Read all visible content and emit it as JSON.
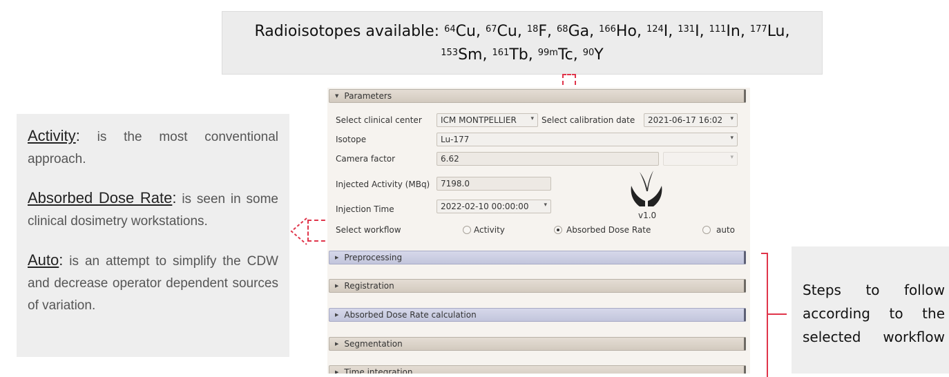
{
  "isotopes": {
    "prefix": "Radioisotopes available:",
    "items": [
      {
        "mass": "64",
        "symbol": "Cu"
      },
      {
        "mass": "67",
        "symbol": "Cu"
      },
      {
        "mass": "18",
        "symbol": "F"
      },
      {
        "mass": "68",
        "symbol": "Ga"
      },
      {
        "mass": "166",
        "symbol": "Ho"
      },
      {
        "mass": "124",
        "symbol": "I"
      },
      {
        "mass": "131",
        "symbol": "I"
      },
      {
        "mass": "111",
        "symbol": "In"
      },
      {
        "mass": "177",
        "symbol": "Lu"
      },
      {
        "mass": "153",
        "symbol": "Sm"
      },
      {
        "mass": "161",
        "symbol": "Tb"
      },
      {
        "mass": "99m",
        "symbol": "Tc"
      },
      {
        "mass": "90",
        "symbol": "Y"
      }
    ]
  },
  "notes": {
    "activity_term": "Activity",
    "activity_text": " is the most conventional approach.",
    "adr_term": "Absorbed Dose Rate",
    "adr_text": " is seen in some clinical dosimetry workstations.",
    "auto_term": "Auto",
    "auto_text": " is an attempt to simplify the CDW and decrease operator dependent sources of variation."
  },
  "steps_note": "Steps to follow according to the selected workflow",
  "app": {
    "parameters_title": "Parameters",
    "clinical_center_label": "Select clinical center",
    "clinical_center_value": "ICM MONTPELLIER",
    "calibration_date_label": "Select calibration date",
    "calibration_date_value": "2021-06-17 16:02",
    "isotope_label": "Isotope",
    "isotope_value": "Lu-177",
    "camera_factor_label": "Camera factor",
    "camera_factor_value": "6.62",
    "injected_activity_label": "Injected Activity (MBq)",
    "injected_activity_value": "7198.0",
    "injection_time_label": "Injection Time",
    "injection_time_value": "2022-02-10 00:00:00",
    "version": "v1.0",
    "workflow_label": "Select workflow",
    "workflow_options": [
      "Activity",
      "Absorbed Dose Rate",
      "auto"
    ],
    "workflow_selected": "Absorbed Dose Rate",
    "sections": [
      "Preprocessing",
      "Registration",
      "Absorbed Dose Rate calculation",
      "Segmentation",
      "Time integration"
    ]
  },
  "colors": {
    "callout": "#e0344a",
    "panel_bg": "#f6f3ef",
    "highlight_section": "#c2c5dc"
  }
}
